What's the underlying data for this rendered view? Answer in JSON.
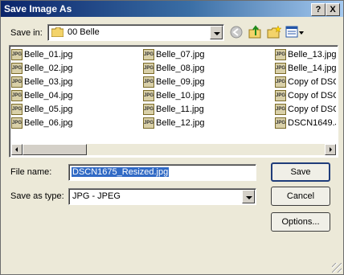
{
  "window": {
    "title": "Save Image As",
    "help_label": "?",
    "close_label": "X"
  },
  "save_in": {
    "label": "Save in:",
    "value": "00 Belle"
  },
  "files": [
    [
      "Belle_01.jpg",
      "Belle_07.jpg",
      "Belle_13.jpg"
    ],
    [
      "Belle_02.jpg",
      "Belle_08.jpg",
      "Belle_14.jpg"
    ],
    [
      "Belle_03.jpg",
      "Belle_09.jpg",
      "Copy of DSC"
    ],
    [
      "Belle_04.jpg",
      "Belle_10.jpg",
      "Copy of DSC"
    ],
    [
      "Belle_05.jpg",
      "Belle_11.jpg",
      "Copy of DSC"
    ],
    [
      "Belle_06.jpg",
      "Belle_12.jpg",
      "DSCN1649.J"
    ]
  ],
  "file_icon_label": "JPG",
  "filename": {
    "label": "File name:",
    "value": "DSCN1675_Resized.jpg"
  },
  "save_type": {
    "label": "Save as type:",
    "value": "JPG - JPEG"
  },
  "buttons": {
    "save": "Save",
    "cancel": "Cancel",
    "options": "Options..."
  },
  "icons": {
    "back": "back-arrow-icon",
    "up": "up-folder-icon",
    "new_folder": "new-folder-icon",
    "views": "views-menu-icon"
  }
}
